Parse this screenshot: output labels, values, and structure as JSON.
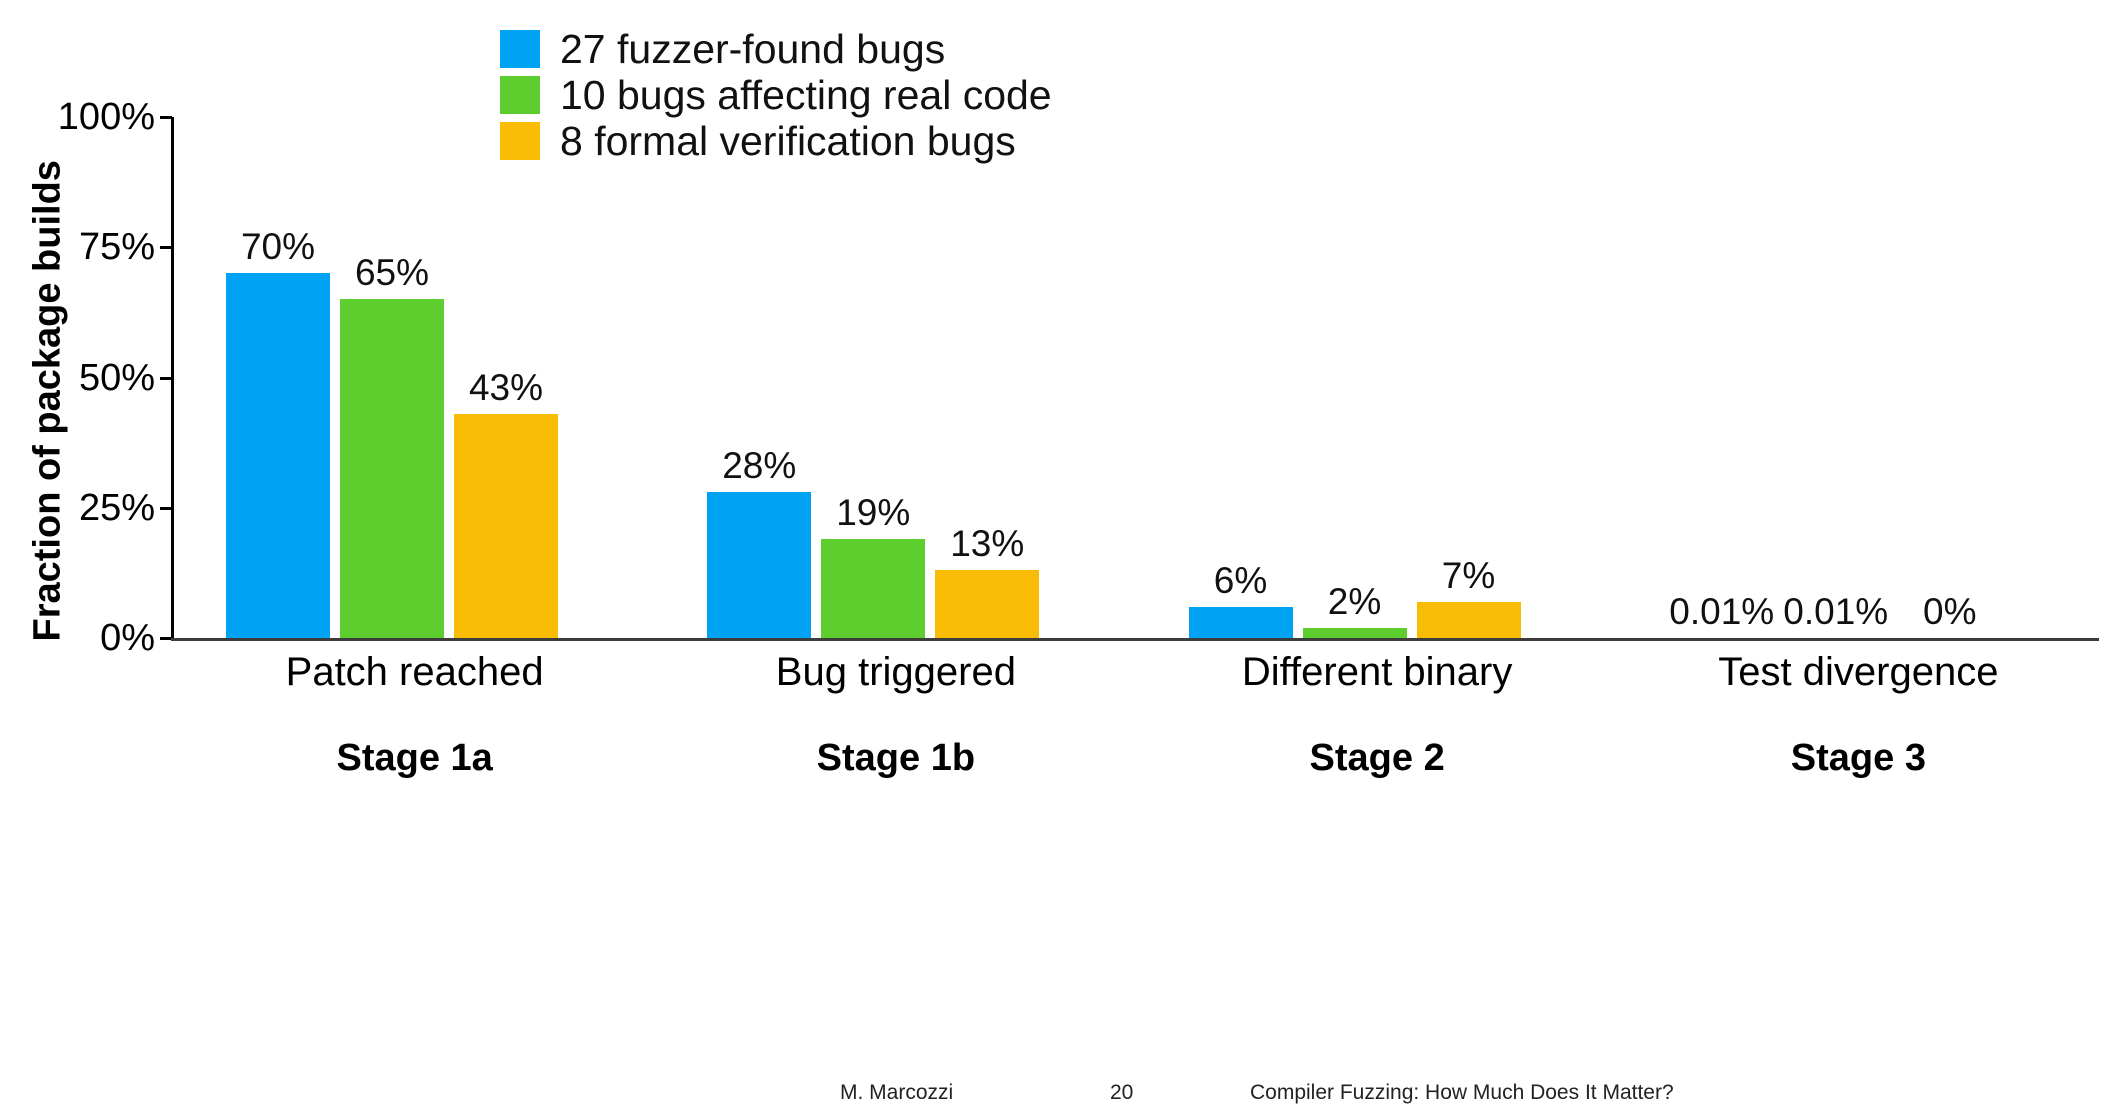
{
  "legend": {
    "items": [
      {
        "label": "27 fuzzer-found bugs",
        "color": "#00a2f3"
      },
      {
        "label": "10 bugs affecting real code",
        "color": "#5ece2e"
      },
      {
        "label": "8 formal verification bugs",
        "color": "#f8bc04"
      }
    ]
  },
  "axis": {
    "ylabel": "Fraction of package builds",
    "yticks": [
      "0%",
      "25%",
      "50%",
      "75%",
      "100%"
    ],
    "ytick_values": [
      0,
      25,
      50,
      75,
      100
    ]
  },
  "groups": [
    {
      "name": "Patch reached",
      "stage": "Stage 1a"
    },
    {
      "name": "Bug triggered",
      "stage": "Stage 1b"
    },
    {
      "name": "Different binary",
      "stage": "Stage 2"
    },
    {
      "name": "Test divergence",
      "stage": "Stage 3"
    }
  ],
  "footer": {
    "author": "M. Marcozzi",
    "page": "20",
    "title": "Compiler Fuzzing: How Much Does It Matter?"
  },
  "chart_data": {
    "type": "bar",
    "title": "",
    "xlabel": "",
    "ylabel": "Fraction of package builds",
    "ylim": [
      0,
      100
    ],
    "grid": false,
    "legend_position": "top-left",
    "categories": [
      "Patch reached",
      "Bug triggered",
      "Different binary",
      "Test divergence"
    ],
    "subcategories": [
      "Stage 1a",
      "Stage 1b",
      "Stage 2",
      "Stage 3"
    ],
    "series": [
      {
        "name": "27 fuzzer-found bugs",
        "color": "#00a2f3",
        "values": [
          70,
          28,
          6,
          0.01
        ],
        "labels": [
          "70%",
          "28%",
          "6%",
          "0.01%"
        ]
      },
      {
        "name": "10 bugs affecting real code",
        "color": "#5ece2e",
        "values": [
          65,
          19,
          2,
          0.01
        ],
        "labels": [
          "65%",
          "19%",
          "2%",
          "0.01%"
        ]
      },
      {
        "name": "8 formal verification bugs",
        "color": "#f8bc04",
        "values": [
          43,
          13,
          7,
          0
        ],
        "labels": [
          "43%",
          "13%",
          "7%",
          "0%"
        ]
      }
    ]
  }
}
